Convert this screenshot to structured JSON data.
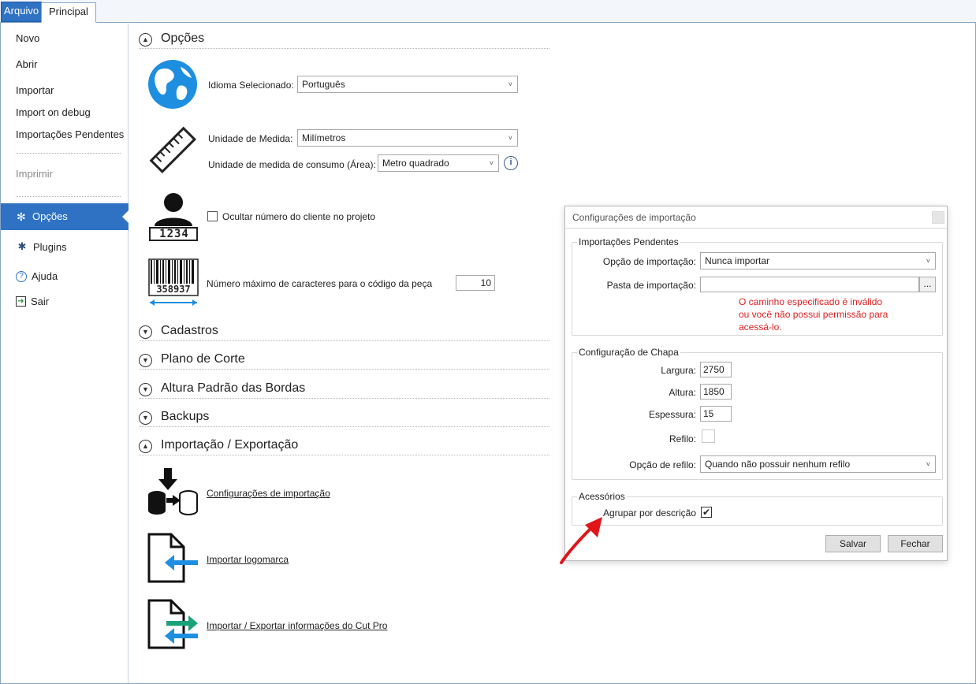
{
  "ribbon": {
    "file_tab": "Arquivo",
    "home_tab": "Principal"
  },
  "sidebar": {
    "items": [
      "Novo",
      "Abrir",
      "Importar",
      "Import on debug",
      "Importações Pendentes"
    ],
    "print": "Imprimir",
    "active": "Opções",
    "plugins": "Plugins",
    "help": "Ajuda",
    "exit": "Sair"
  },
  "main": {
    "options_title": "Opções",
    "language_label": "Idioma Selecionado:",
    "language_value": "Português",
    "unit_label": "Unidade de Medida:",
    "unit_value": "Milímetros",
    "consumption_label": "Unidade de medida de consumo (Área):",
    "consumption_value": "Metro quadrado",
    "client_badge": "1234",
    "hide_client_label": "Ocultar número do cliente no projeto",
    "barcode_number": "358937",
    "max_chars_label": "Número máximo de caracteres para o código da peça",
    "max_chars_value": "10",
    "sections": [
      "Cadastros",
      "Plano de Corte",
      "Altura Padrão das Bordas",
      "Backups"
    ],
    "import_export_title": "Importação / Exportação",
    "links": [
      "Configurações de importação",
      "Importar logomarca",
      "Importar / Exportar informações do Cut Pro"
    ]
  },
  "dialog": {
    "title": "Configurações de importação",
    "pending_group": "Importações Pendentes",
    "import_option_label": "Opção de importação:",
    "import_option_value": "Nunca importar",
    "folder_label": "Pasta de importação:",
    "folder_value": "",
    "browse_label": "...",
    "error_lines": [
      "O caminho especificado é inválido",
      "ou você não possui permissão para",
      "acessá-lo."
    ],
    "sheet_group": "Configuração de Chapa",
    "width_label": "Largura:",
    "width_value": "2750",
    "height_label": "Altura:",
    "height_value": "1850",
    "thickness_label": "Espessura:",
    "thickness_value": "15",
    "trim_label": "Refilo:",
    "trim_option_label": "Opção de refilo:",
    "trim_option_value": "Quando não possuir nenhum refilo",
    "accessories_group": "Acessórios",
    "group_by_label": "Agrupar por descrição",
    "group_by_checked": true,
    "save_label": "Salvar",
    "close_label": "Fechar"
  },
  "colors": {
    "accent": "#2f72c4",
    "error": "#e02020",
    "arrow": "#e0151a"
  }
}
